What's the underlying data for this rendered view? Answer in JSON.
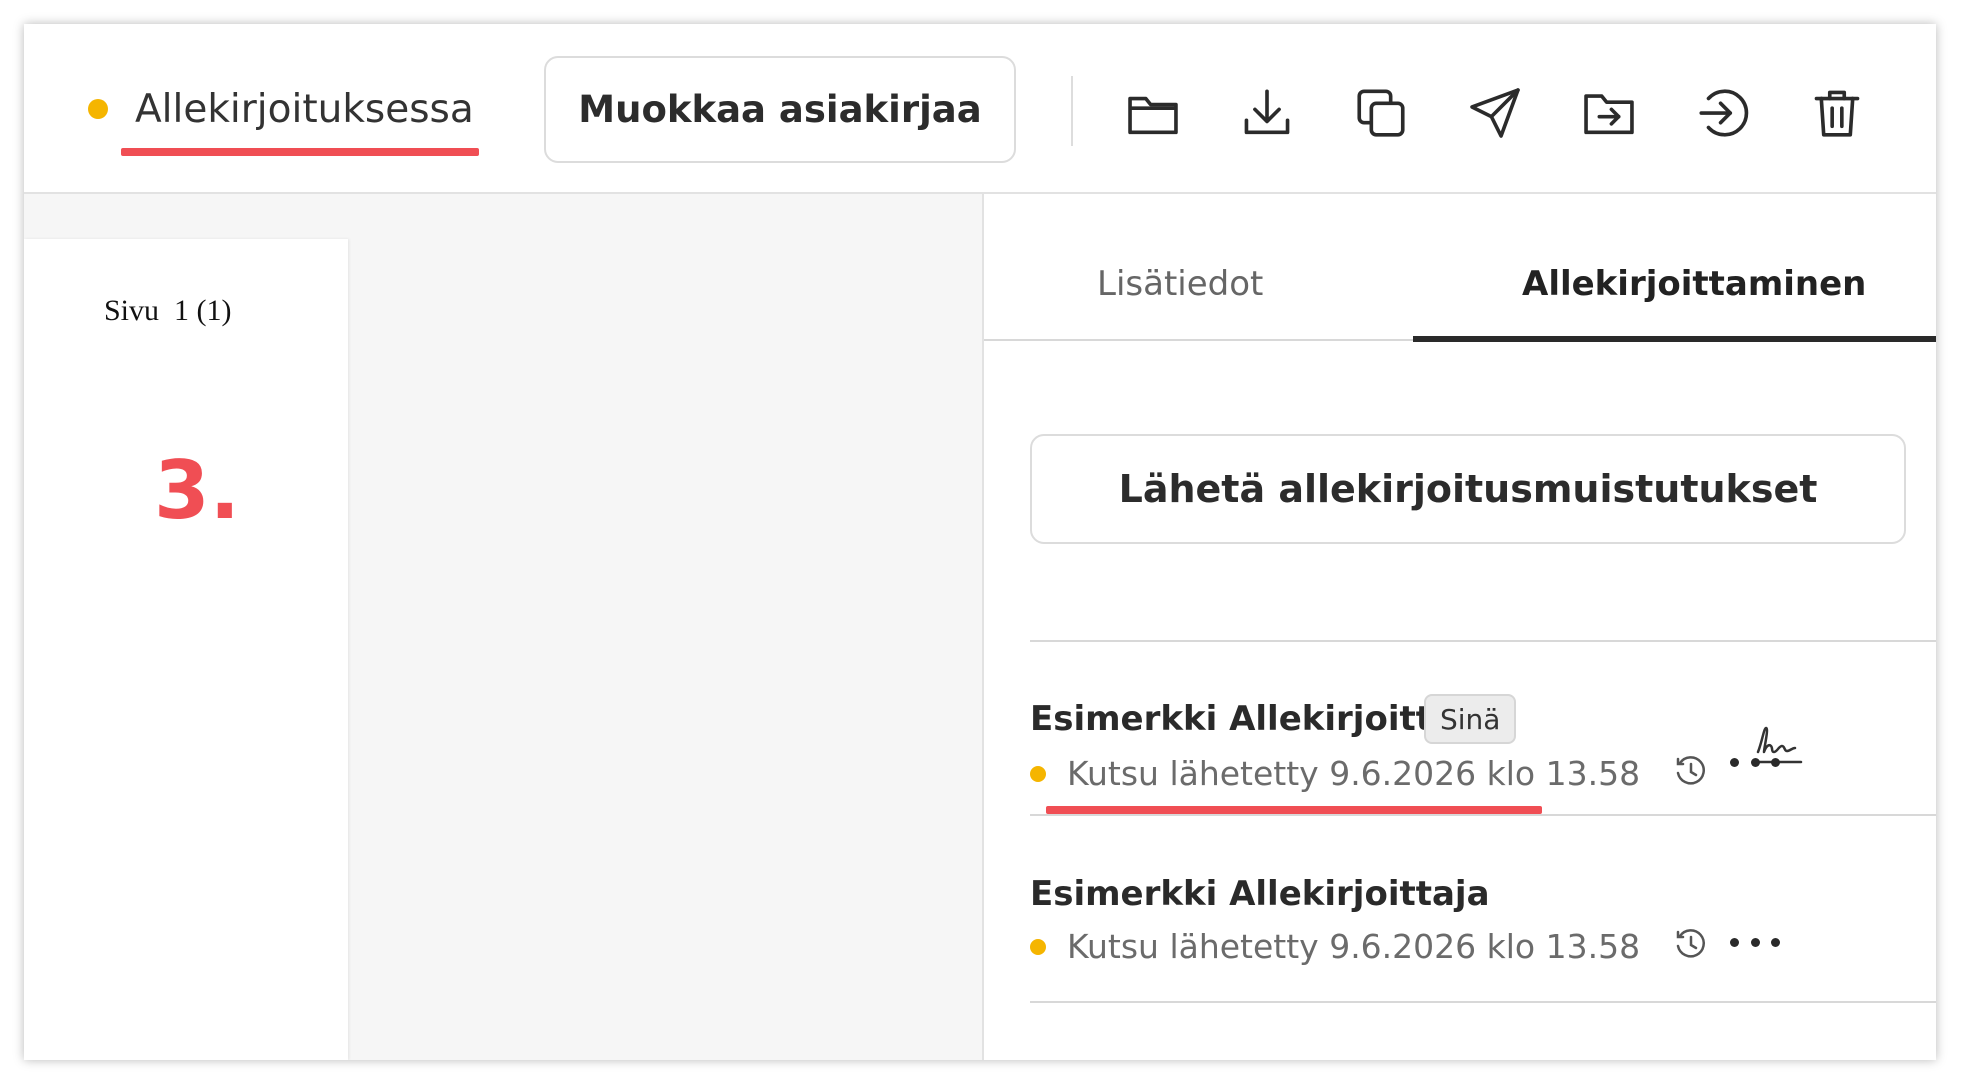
{
  "header": {
    "status_label": "Allekirjoituksessa",
    "edit_button_label": "Muokkaa asiakirjaa",
    "toolbar_icons": [
      "folder-icon",
      "download-icon",
      "copy-icon",
      "send-icon",
      "move-to-folder-icon",
      "sign-in-icon",
      "trash-icon"
    ]
  },
  "document": {
    "page_label": "Sivu  1 (1)",
    "step_number": "3."
  },
  "panel": {
    "tabs": [
      {
        "label": "Lisätiedot",
        "active": false
      },
      {
        "label": "Allekirjoittaminen",
        "active": true
      }
    ],
    "remind_button_label": "Lähetä allekirjoitusmuistutukset",
    "signers": [
      {
        "name": "Esimerkki Allekirjoittaja",
        "badge": "Sinä",
        "status": "Kutsu lähetetty 9.6.2026 klo 13.58"
      },
      {
        "name": "Esimerkki Allekirjoittaja",
        "status": "Kutsu lähetetty 9.6.2026 klo 13.58"
      }
    ]
  },
  "colors": {
    "status_dot": "#f5b500",
    "highlight": "#f04e54"
  }
}
